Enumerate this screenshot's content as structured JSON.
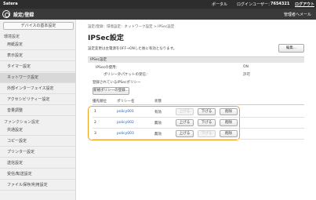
{
  "topbar": {
    "brand": "Satera",
    "portal": "ポータル",
    "user_label": "ログインユーザー：",
    "user_id": "7654321",
    "logout": "ログアウト"
  },
  "titlebar": {
    "title": "設定/登録",
    "mail_to_admin": "管理者へメール"
  },
  "sidebar": {
    "top_button": "デバイスの基本設定",
    "preferences_head": "環境設定",
    "preferences": [
      "用紙設定",
      "表示設定",
      "タイマー設定",
      "ネットワーク設定",
      "外部インターフェイス設定",
      "アクセシビリティー設定",
      "音量調整"
    ],
    "function_head": "ファンクション設定",
    "functions": [
      "共通設定",
      "コピー設定",
      "プリンター設定",
      "送信設定",
      "受信/転送設定",
      "ファイル保存/利用設定"
    ]
  },
  "main": {
    "breadcrumb": "設定/登録：環境設定：ネットワーク設定 > IPSec設定",
    "title": "IPSec設定",
    "notice": "設定変更は主電源をOFF→ONした後に有効となります。",
    "edit_button": "編集...",
    "section": "IPSec設定",
    "use_ipsec_label": "IPSecの使用：",
    "use_ipsec_value": "ON",
    "receive_policy_label": "ポリシー外パケットの受信：",
    "receive_policy_value": "許可",
    "registered_label": "登録されているIPSecポリシー",
    "register_button": "新規ポリシーの登録...",
    "columns": [
      "優先順位",
      "ポリシー名",
      "状態"
    ],
    "policies": [
      {
        "priority": "1",
        "name": "policy001",
        "status": "有効",
        "up": "上げる",
        "down": "下げる",
        "delete": "削除",
        "up_disabled": true,
        "down_disabled": false
      },
      {
        "priority": "2",
        "name": "policy002",
        "status": "無効",
        "up": "上げる",
        "down": "下げる",
        "delete": "削除",
        "up_disabled": false,
        "down_disabled": false
      },
      {
        "priority": "3",
        "name": "policy003",
        "status": "無効",
        "up": "上げる",
        "down": "下げる",
        "delete": "削除",
        "up_disabled": false,
        "down_disabled": true
      }
    ]
  }
}
